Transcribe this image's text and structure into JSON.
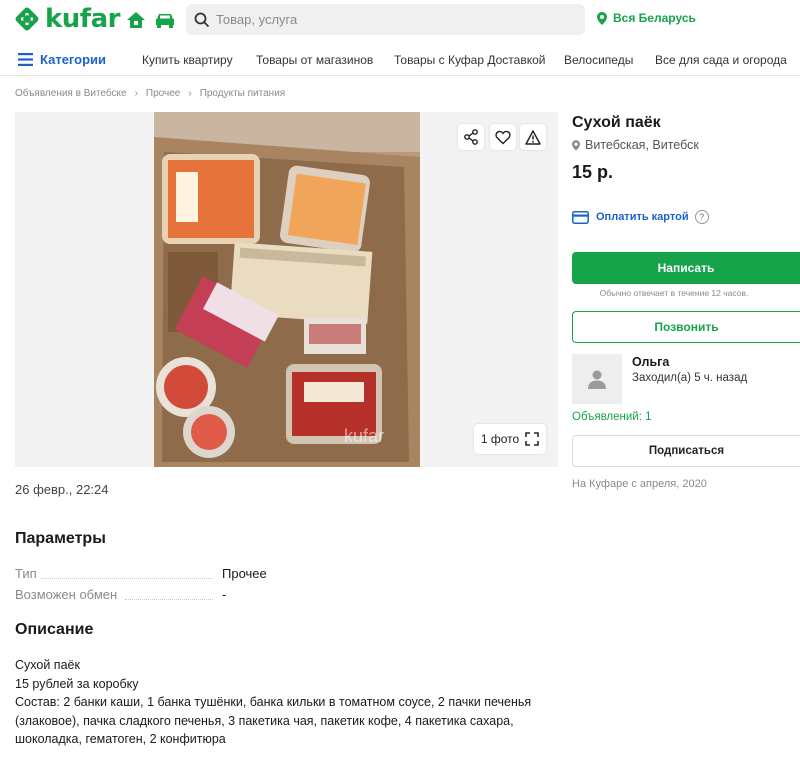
{
  "header": {
    "logo_text": "kufar",
    "search": {
      "placeholder": "Товар, услуга"
    },
    "region": "Вся Беларусь",
    "brand_color": "#17a34a"
  },
  "nav": {
    "categories_label": "Категории",
    "items": [
      "Купить квартиру",
      "Товары от магазинов",
      "Товары с Куфар Доставкой",
      "Велосипеды",
      "Все для сада и огорода"
    ]
  },
  "breadcrumb": [
    "Объявления в Витебске",
    "Прочее",
    "Продукты питания"
  ],
  "gallery": {
    "photo_count_label": "1 фото",
    "watermark": "kufar"
  },
  "listing": {
    "date": "26 февр., 22:24",
    "title": "Сухой паёк",
    "location": "Витебская, Витебск",
    "price": "15 р."
  },
  "actions": {
    "pay_card": "Оплатить картой",
    "help": "?",
    "write": "Написать",
    "reply_note": "Обычно отвечает в течение 12 часов.",
    "call": "Позвонить",
    "subscribe": "Подписаться"
  },
  "seller": {
    "name": "Ольга",
    "last_seen": "Заходил(а) 5 ч. назад",
    "ads_count": "Объявлений: 1",
    "since": "На Куфаре с апреля, 2020"
  },
  "params": {
    "heading": "Параметры",
    "rows": [
      {
        "key": "Тип",
        "value": "Прочее"
      },
      {
        "key": "Возможен обмен",
        "value": "-"
      }
    ]
  },
  "description": {
    "heading": "Описание",
    "lines": [
      "Сухой паёк",
      "15 рублей за коробку",
      "Состав: 2 банки каши, 1 банка тушёнки, банка кильки в томатном соусе, 2 пачки печенья (злаковое), пачка сладкого печенья, 3 пакетика чая, пакетик кофе, 4 пакетика сахара, шоколадка, гематоген, 2 конфитюра"
    ]
  },
  "icons": {
    "logo": "kufar-diamond-logo",
    "home": "home-icon",
    "car": "car-icon",
    "search": "search-icon",
    "pin": "location-pin-icon",
    "menu": "hamburger-icon",
    "share": "share-icon",
    "favorite": "heart-icon",
    "report": "warning-icon",
    "fullscreen": "expand-icon",
    "card": "card-icon",
    "user": "user-icon"
  }
}
